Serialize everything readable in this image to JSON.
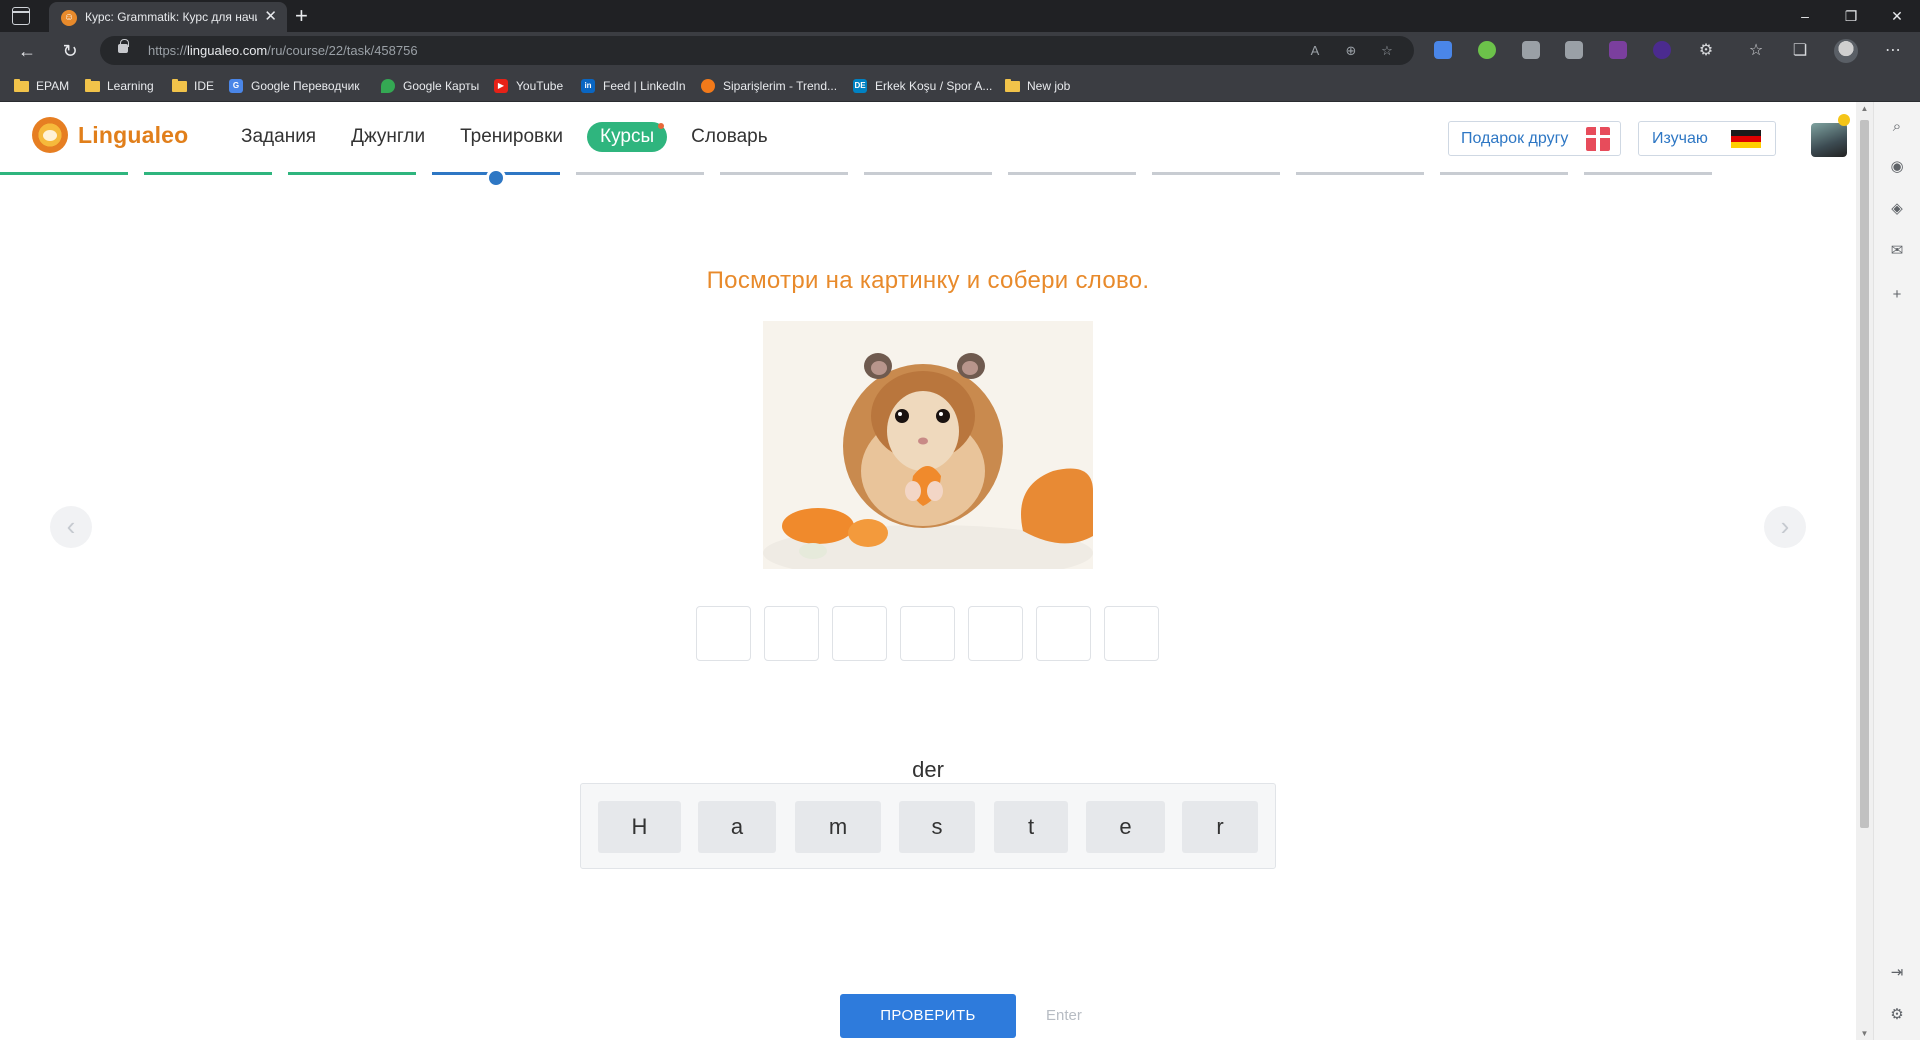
{
  "browser": {
    "tab_title": "Курс: Grammatik: Курс для начи",
    "url_prefix": "https://",
    "url_host": "lingualeo.com",
    "url_path": "/ru/course/22/task/458756",
    "bookmarks": [
      {
        "label": "EPAM",
        "icon": "folder-icon"
      },
      {
        "label": "Learning",
        "icon": "folder-icon"
      },
      {
        "label": "IDE",
        "icon": "folder-icon"
      },
      {
        "label": "Google Переводчик",
        "icon": "google-translate-icon"
      },
      {
        "label": "Google Карты",
        "icon": "google-maps-icon"
      },
      {
        "label": "YouTube",
        "icon": "youtube-icon"
      },
      {
        "label": "Feed | LinkedIn",
        "icon": "linkedin-icon"
      },
      {
        "label": "Siparişlerim - Trend...",
        "icon": "trendyol-icon"
      },
      {
        "label": "Erkek Koşu / Spor A...",
        "icon": "decathlon-icon"
      },
      {
        "label": "New job",
        "icon": "folder-icon"
      }
    ]
  },
  "site": {
    "logo_text": "Lingualeo",
    "nav": [
      "Задания",
      "Джунгли",
      "Тренировки",
      "Курсы",
      "Словарь"
    ],
    "active_nav": "Курсы",
    "gift_label": "Подарок другу",
    "learning_label": "Изучаю",
    "learning_language_flag": "flag-germany-icon"
  },
  "progress": {
    "total_steps": 12,
    "completed_steps": 3,
    "current_step": 4
  },
  "task": {
    "instruction": "Посмотри на картинку и собери слово.",
    "image_subject": "hamster-eating-carrot-image",
    "slot_count": 7,
    "article": "der",
    "letters": [
      "H",
      "a",
      "m",
      "s",
      "t",
      "e",
      "r"
    ],
    "check_label": "ПРОВЕРИТЬ",
    "hint_label": "Enter"
  },
  "colors": {
    "accent_orange": "#e88a2b",
    "brand_green": "#2fb57e",
    "primary_blue": "#2e7bdc"
  }
}
